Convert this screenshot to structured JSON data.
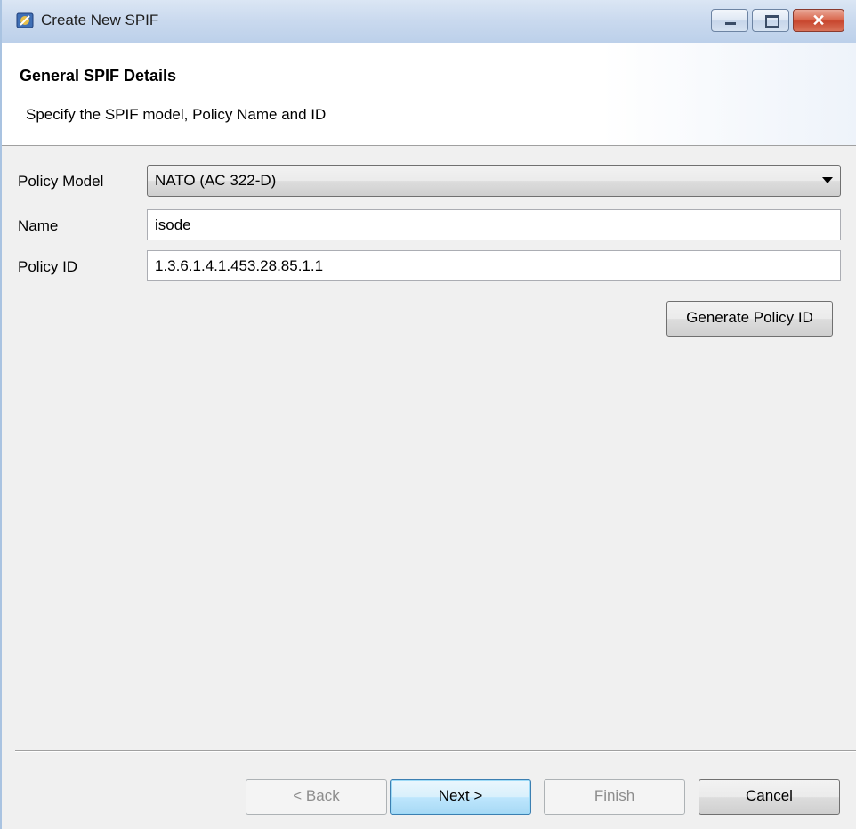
{
  "window": {
    "title": "Create New SPIF",
    "icon": "app-icon",
    "controls": {
      "minimize": "minimize-icon",
      "maximize": "maximize-icon",
      "close": "close-icon",
      "close_glyph": "✕"
    }
  },
  "header": {
    "title": "General SPIF Details",
    "description": "Specify the SPIF model, Policy Name and ID"
  },
  "form": {
    "policy_model": {
      "label": "Policy Model",
      "value": "NATO (AC 322-D)"
    },
    "name": {
      "label": "Name",
      "value": "isode"
    },
    "policy_id": {
      "label": "Policy ID",
      "value": "1.3.6.1.4.1.453.28.85.1.1"
    },
    "generate_button": "Generate Policy ID"
  },
  "footer": {
    "back": {
      "label": "< Back",
      "enabled": false
    },
    "next": {
      "label": "Next >",
      "enabled": true
    },
    "finish": {
      "label": "Finish",
      "enabled": false
    },
    "cancel": {
      "label": "Cancel",
      "enabled": true
    }
  },
  "colors": {
    "titlebar": "#c9d9ee",
    "close_button": "#c7452d",
    "default_button_border": "#3c7fb1",
    "dialog_background": "#f0f0f0"
  }
}
